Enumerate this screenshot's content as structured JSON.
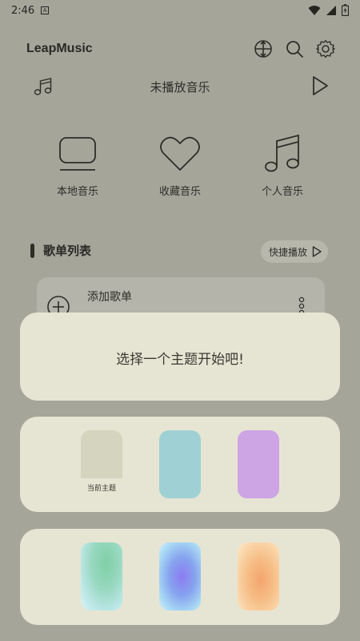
{
  "status_bar": {
    "time": "2:46",
    "notification": "A"
  },
  "header": {
    "title": "LeapMusic"
  },
  "now_playing": {
    "text": "未播放音乐"
  },
  "quick_access": [
    {
      "label": "本地音乐",
      "icon": "monitor-icon"
    },
    {
      "label": "收藏音乐",
      "icon": "heart-icon"
    },
    {
      "label": "个人音乐",
      "icon": "music-note-icon"
    }
  ],
  "playlist_section": {
    "title": "歌单列表",
    "quick_play_label": "快捷播放"
  },
  "playlist_card": {
    "label": "添加歌单"
  },
  "theme_dialog": {
    "title": "选择一个主题开始吧!",
    "current_theme_label": "当前主题"
  },
  "theme_colors": {
    "current": "#d5d4bf",
    "teal": "#9fd0d4",
    "purple": "#cda4e4",
    "green_gradient": "#7fcfa6",
    "blue_gradient": "#8c7cf0",
    "orange_gradient": "#f4a56e"
  }
}
